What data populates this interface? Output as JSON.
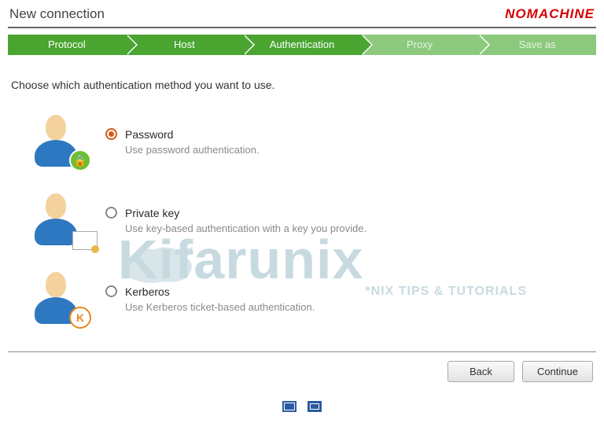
{
  "header": {
    "title": "New connection",
    "brand": "NOMACHINE"
  },
  "steps": [
    {
      "label": "Protocol",
      "state": "done"
    },
    {
      "label": "Host",
      "state": "done"
    },
    {
      "label": "Authentication",
      "state": "current"
    },
    {
      "label": "Proxy",
      "state": "todo"
    },
    {
      "label": "Save as",
      "state": "todo"
    }
  ],
  "prompt": "Choose which authentication method you want to use.",
  "options": [
    {
      "id": "password",
      "label": "Password",
      "desc": "Use password authentication.",
      "selected": true,
      "badge": "lock"
    },
    {
      "id": "private-key",
      "label": "Private key",
      "desc": "Use key-based authentication with a key you provide.",
      "selected": false,
      "badge": "cert"
    },
    {
      "id": "kerberos",
      "label": "Kerberos",
      "desc": "Use Kerberos ticket-based authentication.",
      "selected": false,
      "badge": "k"
    }
  ],
  "buttons": {
    "back": "Back",
    "continue": "Continue"
  },
  "watermark": {
    "main": "Kifarunix",
    "sub": "*NIX TIPS & TUTORIALS"
  }
}
